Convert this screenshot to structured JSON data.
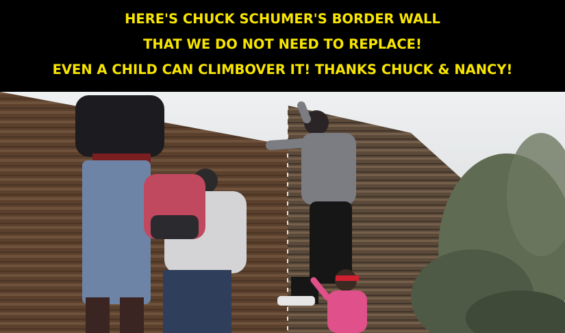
{
  "meme": {
    "caption_lines": [
      "HERE'S CHUCK SCHUMER'S BORDER WALL",
      "THAT WE DO NOT NEED TO REPLACE!",
      "EVEN A CHILD CAN CLIMBOVER IT! THANKS CHUCK & NANCY!"
    ],
    "caption_color": "#f8e600",
    "background_color": "#000000"
  },
  "photo": {
    "scene": "people climbing a rusted slatted border wall",
    "palette": {
      "sky": "#d9dadb",
      "wall": "#5a4634",
      "rust": "#7a4a2c",
      "vegetation": "#5f6b52",
      "child_shirt": "#e0508a",
      "backpack": "#c0485f"
    }
  }
}
